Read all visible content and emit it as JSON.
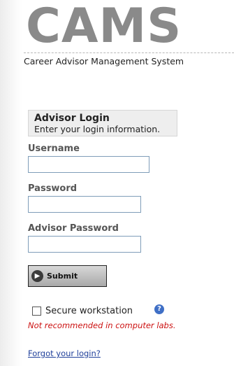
{
  "app": {
    "logo": "CAMS",
    "subtitle": "Career Advisor Management System"
  },
  "login_box": {
    "title": "Advisor Login",
    "instructions": "Enter your login information."
  },
  "fields": {
    "username_label": "Username",
    "username_value": "",
    "password_label": "Password",
    "password_value": "",
    "advisor_password_label": "Advisor Password",
    "advisor_password_value": ""
  },
  "submit": {
    "label": "Submit",
    "icon": "arrow-right-circle-icon"
  },
  "secure": {
    "label": "Secure workstation",
    "checked": false,
    "help_icon": "question-circle-icon",
    "warning": "Not recommended in computer labs."
  },
  "links": {
    "forgot": "Forgot your login?"
  },
  "colors": {
    "logo": "#8a8a8a",
    "warning": "#cc1111",
    "link": "#1f3f9a",
    "help": "#3f6fc6"
  }
}
